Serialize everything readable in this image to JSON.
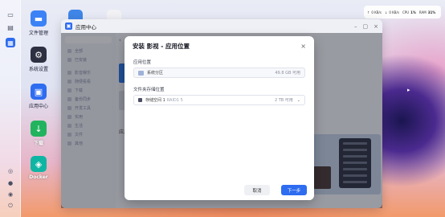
{
  "desktop": {
    "icons": [
      {
        "label": "文件管理",
        "icon": "folder-icon",
        "color": "#3b82f6"
      },
      {
        "label": "系统设置",
        "icon": "gear-icon",
        "color": "#2d3040"
      },
      {
        "label": "应用中心",
        "icon": "app-store-icon",
        "color": "#2e6cf0"
      },
      {
        "label": "下载",
        "icon": "download-icon",
        "color": "#22b35e"
      },
      {
        "label": "Docker",
        "icon": "docker-icon",
        "color": "#0fb5a3"
      }
    ]
  },
  "system_widget": {
    "rx": "0 KB/s",
    "tx": "0 KB/s",
    "cpu_label": "CPU",
    "cpu_value": "1%",
    "ram_label": "RAM",
    "ram_value": "31%"
  },
  "app_window": {
    "title": "应用中心",
    "sidebar": {
      "items": [
        {
          "label": "全部"
        },
        {
          "label": "已安装"
        },
        {
          "label": "影音娱乐"
        },
        {
          "label": "随便看看"
        },
        {
          "label": "下载"
        },
        {
          "label": "备份同步"
        },
        {
          "label": "开发工具"
        },
        {
          "label": "实用"
        },
        {
          "label": "生活"
        },
        {
          "label": "文件"
        },
        {
          "label": "其他"
        }
      ]
    },
    "section_title": "应用"
  },
  "modal": {
    "title": "安装 影视 - 应用位置",
    "install_location": {
      "label": "应用位置",
      "value": "系统分区",
      "available": "49.8 GB 可用"
    },
    "storage_location": {
      "label": "文件夹存储位置",
      "value": "存储空间 1",
      "sub": "RAID1 5",
      "available": "2 TB 可用"
    },
    "cancel_label": "取消",
    "next_label": "下一步"
  }
}
